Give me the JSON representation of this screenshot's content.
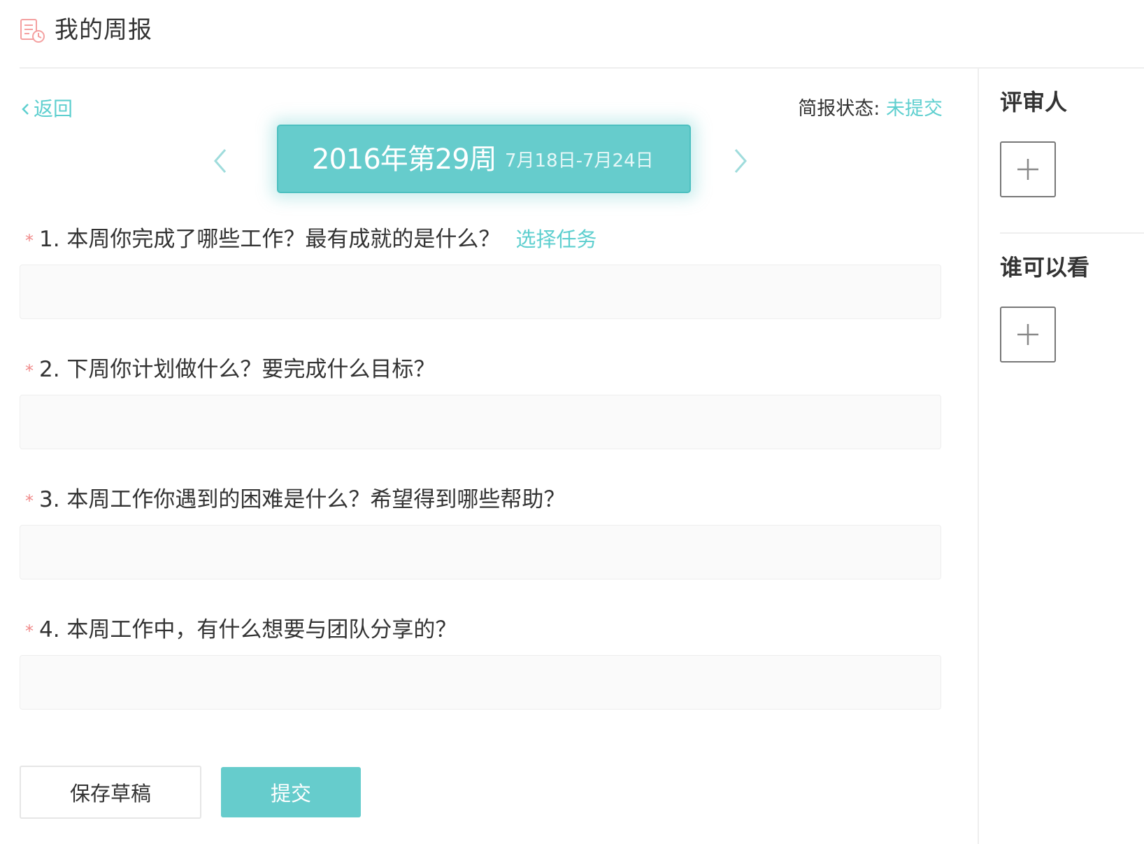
{
  "header": {
    "title": "我的周报",
    "icon": "report-clock-icon"
  },
  "nav": {
    "back_label": "返回"
  },
  "status": {
    "label": "简报状态:",
    "value": "未提交"
  },
  "week": {
    "title": "2016年第29周",
    "range": "7月18日-7月24日"
  },
  "questions": [
    {
      "star": "*",
      "text": "1. 本周你完成了哪些工作？最有成就的是什么？",
      "link": "选择任务",
      "value": ""
    },
    {
      "star": "*",
      "text": "2. 下周你计划做什么？要完成什么目标？",
      "value": ""
    },
    {
      "star": "*",
      "text": "3. 本周工作你遇到的困难是什么？希望得到哪些帮助？",
      "value": ""
    },
    {
      "star": "*",
      "text": "4. 本周工作中，有什么想要与团队分享的？",
      "value": ""
    }
  ],
  "actions": {
    "save_label": "保存草稿",
    "submit_label": "提交"
  },
  "sidebar": {
    "reviewers_title": "评审人",
    "viewers_title": "谁可以看"
  },
  "colors": {
    "accent": "#66cccc",
    "accent_text": "#5ecfcf",
    "required_star": "#f08a8a"
  }
}
